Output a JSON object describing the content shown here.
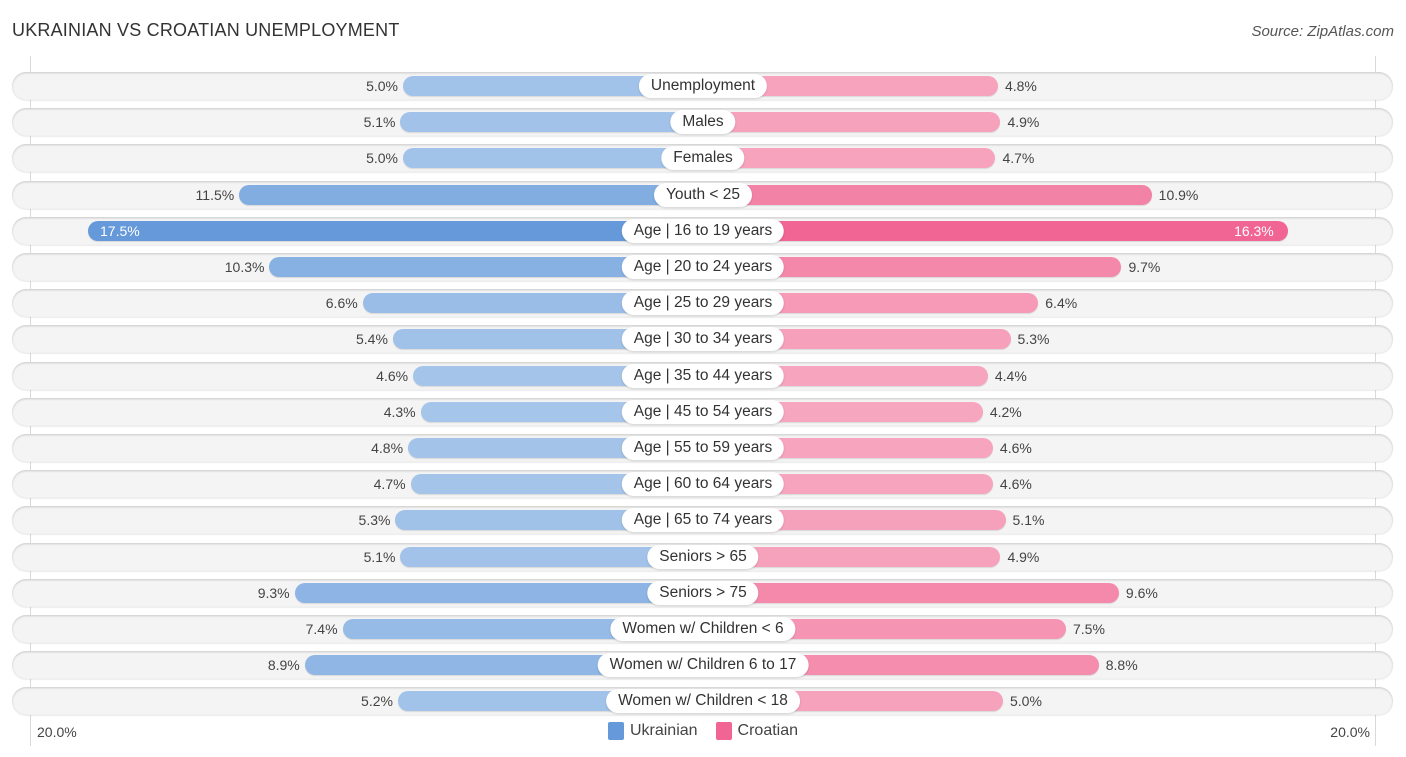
{
  "title": "UKRAINIAN VS CROATIAN UNEMPLOYMENT",
  "source": "Source: ZipAtlas.com",
  "colors": {
    "ukrainian_light": "#a7c6ea",
    "ukrainian_strong": "#6599da",
    "croatian_light": "#f7a7c0",
    "croatian_strong": "#f06593"
  },
  "chart_data": {
    "type": "bar",
    "orientation": "horizontal-diverging",
    "title": "UKRAINIAN VS CROATIAN UNEMPLOYMENT",
    "xlabel": "",
    "ylabel": "",
    "xlim": [
      0,
      20
    ],
    "axis_labels": {
      "left": "20.0%",
      "right": "20.0%"
    },
    "legend_position": "bottom-center",
    "categories": [
      "Unemployment",
      "Males",
      "Females",
      "Youth < 25",
      "Age | 16 to 19 years",
      "Age | 20 to 24 years",
      "Age | 25 to 29 years",
      "Age | 30 to 34 years",
      "Age | 35 to 44 years",
      "Age | 45 to 54 years",
      "Age | 55 to 59 years",
      "Age | 60 to 64 years",
      "Age | 65 to 74 years",
      "Seniors > 65",
      "Seniors > 75",
      "Women w/ Children < 6",
      "Women w/ Children 6 to 17",
      "Women w/ Children < 18"
    ],
    "series": [
      {
        "name": "Ukrainian",
        "side": "left",
        "values": [
          5.0,
          5.1,
          5.0,
          11.5,
          17.5,
          10.3,
          6.6,
          5.4,
          4.6,
          4.3,
          4.8,
          4.7,
          5.3,
          5.1,
          9.3,
          7.4,
          8.9,
          5.2
        ]
      },
      {
        "name": "Croatian",
        "side": "right",
        "values": [
          4.8,
          4.9,
          4.7,
          10.9,
          16.3,
          9.7,
          6.4,
          5.3,
          4.4,
          4.2,
          4.6,
          4.6,
          5.1,
          4.9,
          9.6,
          7.5,
          8.8,
          5.0
        ]
      }
    ],
    "value_labels": {
      "Ukrainian": [
        "5.0%",
        "5.1%",
        "5.0%",
        "11.5%",
        "17.5%",
        "10.3%",
        "6.6%",
        "5.4%",
        "4.6%",
        "4.3%",
        "4.8%",
        "4.7%",
        "5.3%",
        "5.1%",
        "9.3%",
        "7.4%",
        "8.9%",
        "5.2%"
      ],
      "Croatian": [
        "4.8%",
        "4.9%",
        "4.7%",
        "10.9%",
        "16.3%",
        "9.7%",
        "6.4%",
        "5.3%",
        "4.4%",
        "4.2%",
        "4.6%",
        "4.6%",
        "5.1%",
        "4.9%",
        "9.6%",
        "7.5%",
        "8.8%",
        "5.0%"
      ]
    }
  },
  "legend": [
    {
      "label": "Ukrainian",
      "color": "#6599da"
    },
    {
      "label": "Croatian",
      "color": "#f06593"
    }
  ]
}
